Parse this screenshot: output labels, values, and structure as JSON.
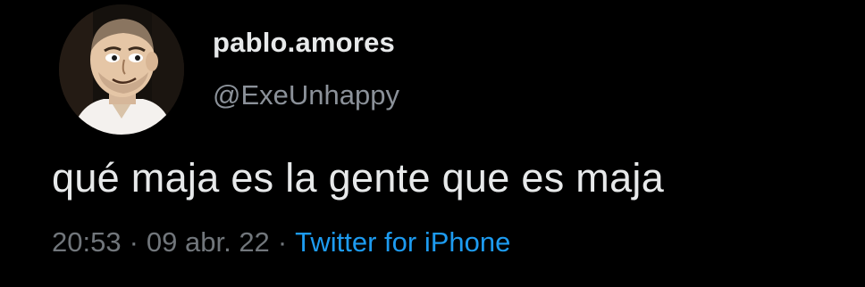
{
  "tweet": {
    "display_name": "pablo.amores",
    "handle": "@ExeUnhappy",
    "text": "qué maja es la gente que es maja",
    "time": "20:53",
    "separator": "·",
    "date": "09 abr. 22",
    "source": "Twitter for iPhone"
  },
  "colors": {
    "background": "#000000",
    "primary_text": "#e7e9ea",
    "secondary_text": "#71767b",
    "link": "#1d9bf0"
  }
}
